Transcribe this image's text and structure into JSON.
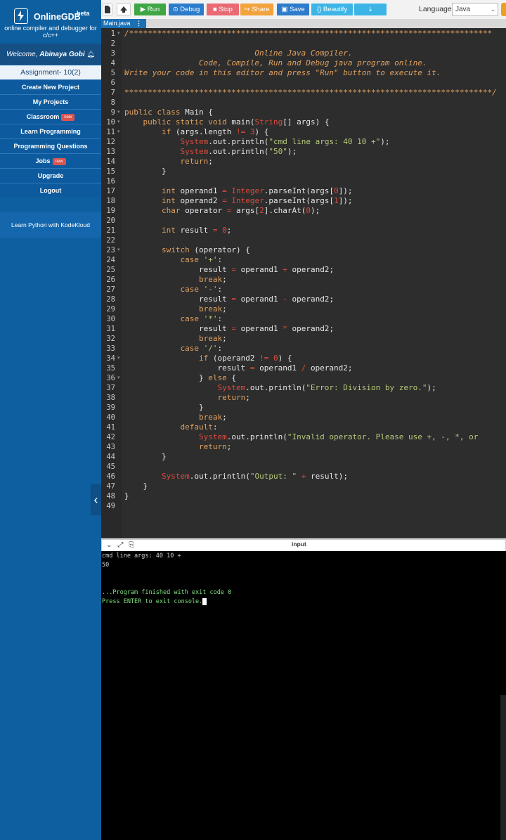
{
  "brand": {
    "name": "OnlineGDB",
    "badge": "beta",
    "tagline": "online compiler and debugger for c/c++"
  },
  "welcome": {
    "prefix": "Welcome,",
    "user": "Abinaya Gobi"
  },
  "sidebar": {
    "assignment": "Assignment- 10(2)",
    "items": [
      {
        "label": "Create New Project"
      },
      {
        "label": "My Projects"
      },
      {
        "label": "Classroom",
        "badge": "new"
      },
      {
        "label": "Learn Programming"
      },
      {
        "label": "Programming Questions"
      },
      {
        "label": "Jobs",
        "badge": "new"
      },
      {
        "label": "Upgrade"
      },
      {
        "label": "Logout"
      }
    ],
    "promo": "Learn Python with KodeKloud"
  },
  "toolbar": {
    "run": "Run",
    "debug": "Debug",
    "stop": "Stop",
    "share": "Share",
    "save": "Save",
    "beautify": "{} Beautify",
    "language_label": "Language",
    "language_value": "Java",
    "colors": {
      "run": "#3ea743",
      "debug": "#2c7ccb",
      "stop": "#e96a73",
      "share": "#f2a33c",
      "save": "#2c7ccb",
      "beautify": "#3cb5e6",
      "download": "#3cb5e6"
    }
  },
  "tab": {
    "file": "Main.java"
  },
  "editor": {
    "lines": [
      "/******************************************************************************",
      "",
      "                            Online Java Compiler.",
      "                Code, Compile, Run and Debug java program online.",
      "Write your code in this editor and press \"Run\" button to execute it.",
      "",
      "*******************************************************************************/",
      "",
      "public class Main {",
      "    public static void main(String[] args) {",
      "        if (args.length != 3) {",
      "            System.out.println(\"cmd line args: 40 10 +\");",
      "            System.out.println(\"50\");",
      "            return;",
      "        }",
      "",
      "        int operand1 = Integer.parseInt(args[0]);",
      "        int operand2 = Integer.parseInt(args[1]);",
      "        char operator = args[2].charAt(0);",
      "",
      "        int result = 0;",
      "",
      "        switch (operator) {",
      "            case '+':",
      "                result = operand1 + operand2;",
      "                break;",
      "            case '-':",
      "                result = operand1 - operand2;",
      "                break;",
      "            case '*':",
      "                result = operand1 * operand2;",
      "                break;",
      "            case '/':",
      "                if (operand2 != 0) {",
      "                    result = operand1 / operand2;",
      "                } else {",
      "                    System.out.println(\"Error: Division by zero.\");",
      "                    return;",
      "                }",
      "                break;",
      "            default:",
      "                System.out.println(\"Invalid operator. Please use +, -, *, or",
      "                return;",
      "        }",
      "",
      "        System.out.println(\"Output: \" + result);",
      "    }",
      "}",
      ""
    ]
  },
  "output": {
    "header": "input",
    "console": [
      {
        "text": "cmd line args: 40 10 +",
        "color": "#d0d0d0"
      },
      {
        "text": "50",
        "color": "#d0d0d0"
      },
      {
        "text": "",
        "color": "#d0d0d0"
      },
      {
        "text": "",
        "color": "#d0d0d0"
      },
      {
        "text": "...Program finished with exit code 0",
        "color": "#7fe07f"
      },
      {
        "text": "Press ENTER to exit console.",
        "color": "#7fe07f"
      }
    ]
  }
}
